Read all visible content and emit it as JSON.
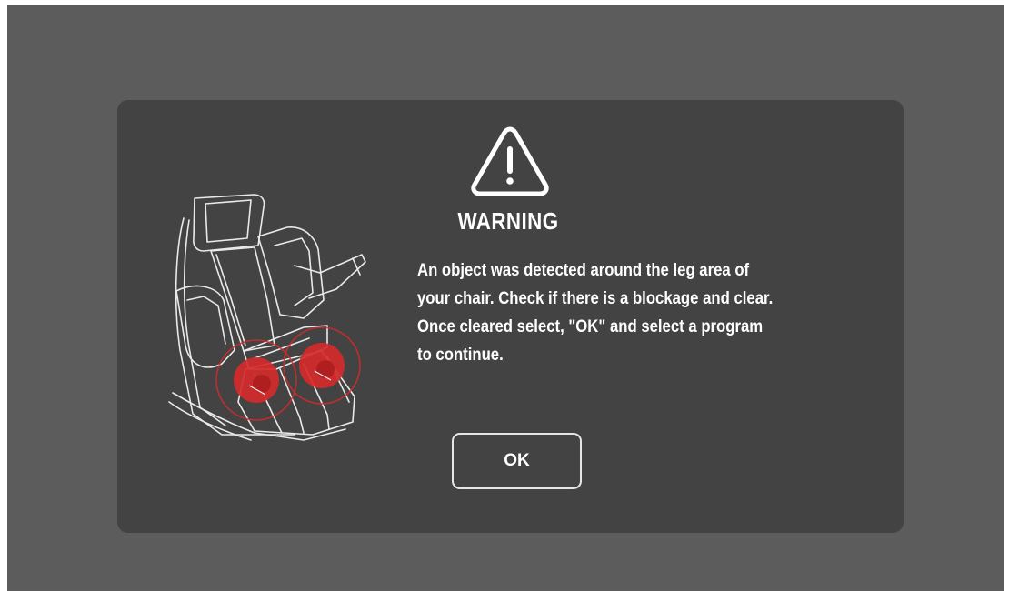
{
  "dialog": {
    "icon": "warning-triangle-icon",
    "title": "WARNING",
    "message_lines": [
      "An object was detected around the leg area of",
      "your chair. Check if there is a blockage and clear.",
      "Once cleared select, \"OK\" and select a program",
      "to continue."
    ],
    "ok_label": "OK",
    "illustration": "massage-chair-leg-area-illustration"
  },
  "colors": {
    "screen_background": "#5c5c5c",
    "dialog_background": "#434343",
    "text": "#ffffff",
    "highlight": "#d42a2a"
  }
}
